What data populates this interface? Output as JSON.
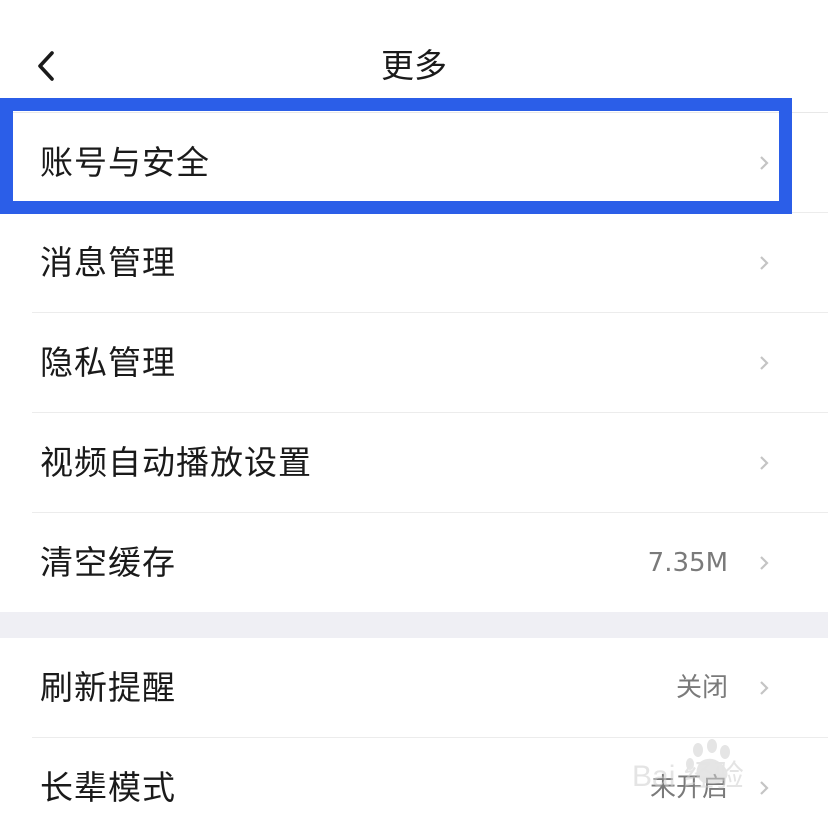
{
  "header": {
    "title": "更多"
  },
  "group1": [
    {
      "label": "账号与安全",
      "value": ""
    },
    {
      "label": "消息管理",
      "value": ""
    },
    {
      "label": "隐私管理",
      "value": ""
    },
    {
      "label": "视频自动播放设置",
      "value": ""
    },
    {
      "label": "清空缓存",
      "value": "7.35M"
    }
  ],
  "group2": [
    {
      "label": "刷新提醒",
      "value": "关闭"
    },
    {
      "label": "长辈模式",
      "value": "未开启"
    }
  ],
  "annotation": {
    "highlight_color": "#2b5ee8"
  },
  "watermark": {
    "text": "Bai 经验"
  },
  "icons": {
    "back": "chevron-left-icon",
    "row_arrow": "chevron-right-icon"
  }
}
